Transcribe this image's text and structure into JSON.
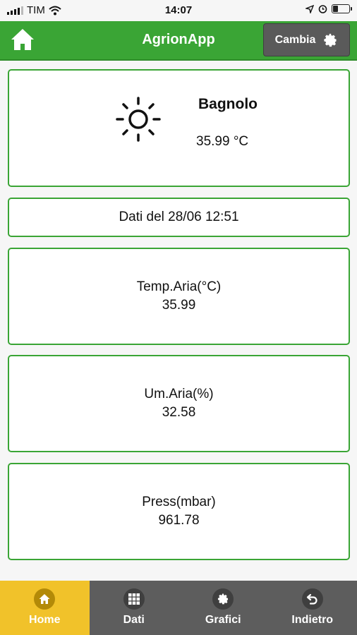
{
  "status_bar": {
    "carrier": "TIM",
    "time": "14:07",
    "battery_level": 0.3
  },
  "header": {
    "title": "AgrionApp",
    "change_label": "Cambia",
    "color": "#3aa535"
  },
  "weather": {
    "icon": "sun-icon",
    "location": "Bagnolo",
    "temperature": "35.99 °C"
  },
  "timestamp": "Dati del 28/06 12:51",
  "readings": [
    {
      "label": "Temp.Aria(°C)",
      "value": "35.99"
    },
    {
      "label": "Um.Aria(%)",
      "value": "32.58"
    },
    {
      "label": "Press(mbar)",
      "value": "961.78"
    }
  ],
  "tabs": [
    {
      "label": "Home",
      "icon": "home-icon",
      "active": true
    },
    {
      "label": "Dati",
      "icon": "grid-icon",
      "active": false
    },
    {
      "label": "Grafici",
      "icon": "gear-icon",
      "active": false
    },
    {
      "label": "Indietro",
      "icon": "back-arrow-icon",
      "active": false
    }
  ]
}
